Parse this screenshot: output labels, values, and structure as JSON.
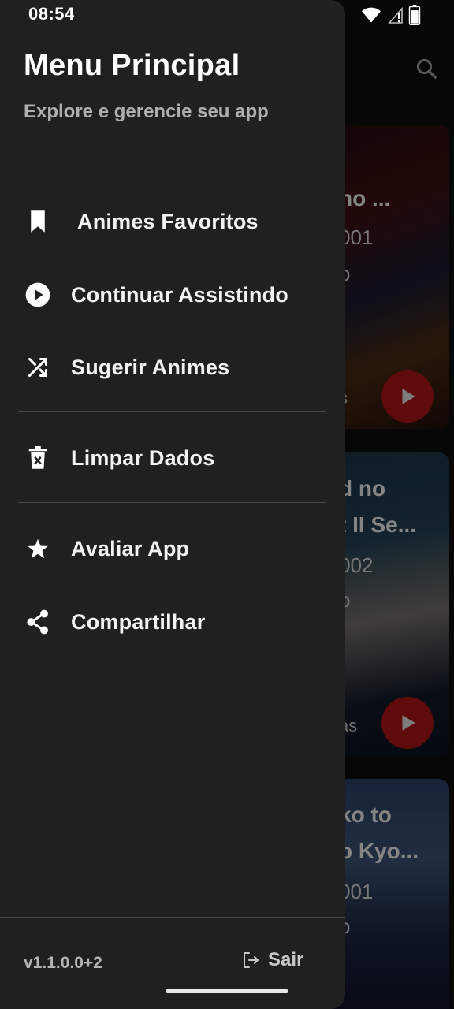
{
  "status_bar": {
    "time": "08:54"
  },
  "drawer": {
    "title": "Menu Principal",
    "subtitle": "Explore e gerencie seu app",
    "items": [
      {
        "label": "Animes Favoritos",
        "icon": "bookmark-icon"
      },
      {
        "label": "Continuar Assistindo",
        "icon": "play-circle-icon"
      },
      {
        "label": "Sugerir Animes",
        "icon": "shuffle-icon"
      },
      {
        "label": "Limpar Dados",
        "icon": "trash-icon"
      },
      {
        "label": "Avaliar App",
        "icon": "star-icon"
      },
      {
        "label": "Compartilhar",
        "icon": "share-icon"
      }
    ],
    "version": "v1.1.0.0+2",
    "logout_label": "Sair"
  },
  "background": {
    "cards": [
      {
        "line1": "no ...",
        "year": "001",
        "ep": "o",
        "status": "s"
      },
      {
        "line1": "d no",
        "line2": "t II Se...",
        "year": "002",
        "ep": "o",
        "status": "as"
      },
      {
        "line1": "ko to",
        "line2": "o Kyo...",
        "year": "001",
        "ep": "o"
      }
    ]
  },
  "colors": {
    "drawer_bg": "#202020",
    "accent_play": "#a51313",
    "divider": "#4a4a4a"
  }
}
